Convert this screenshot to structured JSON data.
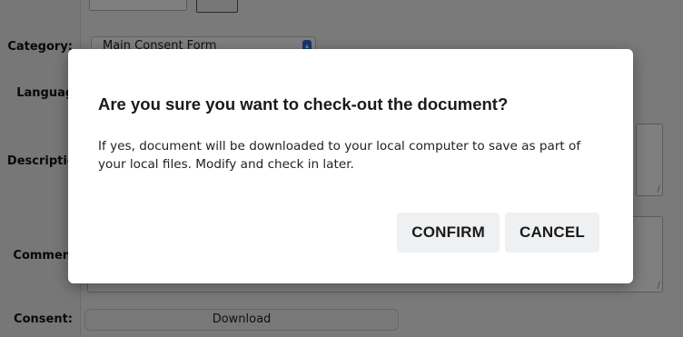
{
  "form": {
    "labels": {
      "category": "Category:",
      "language": "Language",
      "description": "Description",
      "comments": "Comments",
      "consent": "Consent:"
    },
    "category_select": {
      "selected": "Main Consent Form"
    },
    "consent_download_label": "Download"
  },
  "modal": {
    "title": "Are you sure you want to check-out the document?",
    "body": "If yes, document will be downloaded to your local computer to save as part of your local files. Modify and check in later.",
    "confirm_label": "CONFIRM",
    "cancel_label": "CANCEL"
  },
  "colors": {
    "overlay": "#000000",
    "modal_background": "#ffffff",
    "button_background": "#eef0f1",
    "select_accent": "#2f6fe0"
  },
  "icons": [
    "select-arrow-icon",
    "resize-grip-icon"
  ]
}
